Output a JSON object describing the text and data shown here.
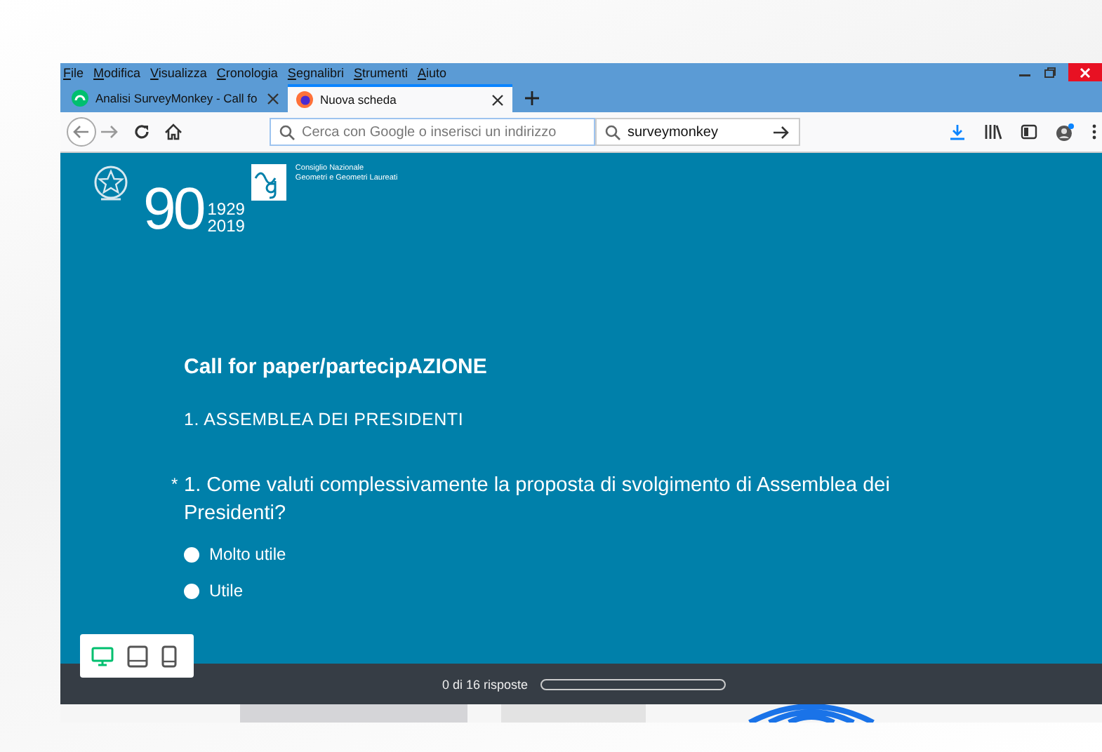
{
  "menu": [
    "File",
    "Modifica",
    "Visualizza",
    "Cronologia",
    "Segnalibri",
    "Strumenti",
    "Aiuto"
  ],
  "tabs": [
    {
      "label": "Analisi SurveyMonkey - Call fo",
      "selected": false
    },
    {
      "label": "Nuova scheda",
      "selected": true
    }
  ],
  "address_bar": {
    "placeholder": "Cerca con Google o inserisci un indirizzo"
  },
  "search_bar": {
    "value": "surveymonkey"
  },
  "logo": {
    "numeral": "90",
    "years": [
      "1929",
      "2019"
    ],
    "org_lines": [
      "Consiglio Nazionale",
      "Geometri e Geometri Laureati"
    ]
  },
  "survey": {
    "title": "Call for paper/partecipAZIONE",
    "section": "1. ASSEMBLEA DEI PRESIDENTI",
    "question": {
      "required": true,
      "marker": "*",
      "text": "1. Come valuti complessivamente la proposta di svolgimento di Assemblea dei Presidenti?"
    },
    "options": [
      {
        "label": "Molto utile",
        "selected": false
      },
      {
        "label": "Utile",
        "selected": false
      }
    ]
  },
  "device_toolbar": [
    {
      "kind": "desktop",
      "selected": true
    },
    {
      "kind": "tablet",
      "selected": false
    },
    {
      "kind": "phone",
      "selected": false
    }
  ],
  "footer": {
    "progress_text": "0 di 16 risposte",
    "level": 0
  }
}
